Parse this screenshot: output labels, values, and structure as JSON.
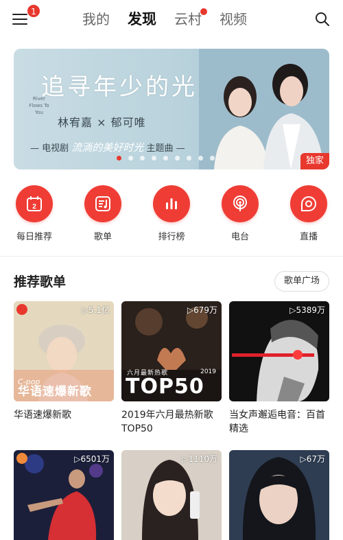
{
  "header": {
    "menu_badge": "1",
    "tabs": [
      {
        "label": "我的"
      },
      {
        "label": "发现"
      },
      {
        "label": "云村"
      },
      {
        "label": "视频"
      }
    ]
  },
  "banner": {
    "title": "追寻年少的光",
    "subtitle_en": "River Flows To You",
    "artists": "林宥嘉 × 郁可唯",
    "theme_left": "— 电视剧",
    "theme_name": "流淌的美好时光",
    "theme_right": "主题曲 —",
    "badge": "独家",
    "dot_count": 9,
    "active_dot": 0
  },
  "quick_nav": [
    {
      "label": "每日推荐",
      "icon": "calendar-icon",
      "day": "2"
    },
    {
      "label": "歌单",
      "icon": "playlist-icon"
    },
    {
      "label": "排行榜",
      "icon": "chart-icon"
    },
    {
      "label": "电台",
      "icon": "radio-icon"
    },
    {
      "label": "直播",
      "icon": "live-icon"
    }
  ],
  "section": {
    "title": "推荐歌单",
    "more": "歌单广场"
  },
  "playlists": [
    {
      "name": "华语速爆新歌",
      "count": "▷5.1亿",
      "cover_line1": "C-pop",
      "cover_line2": "华语速爆新歌"
    },
    {
      "name": "2019年六月最热新歌TOP50",
      "count": "▷679万",
      "cover_line1": "六月最新热歌",
      "cover_line2": "TOP50",
      "cover_year": "2019"
    },
    {
      "name": "当女声邂逅电音：百首精选",
      "count": "▷5389万"
    },
    {
      "name": "",
      "count": "▷6501万"
    },
    {
      "name": "",
      "count": "▷1110万"
    },
    {
      "name": "",
      "count": "▷67万"
    }
  ],
  "colors": {
    "accent": "#e8382e"
  }
}
